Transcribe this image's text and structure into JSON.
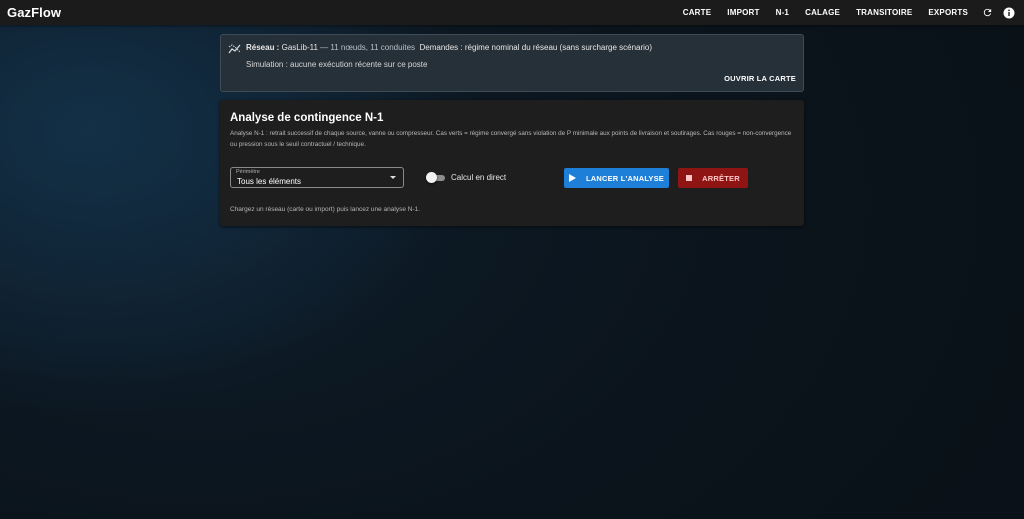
{
  "app": {
    "title": "GazFlow"
  },
  "nav": {
    "items": [
      {
        "label": "CARTE"
      },
      {
        "label": "IMPORT"
      },
      {
        "label": "N-1"
      },
      {
        "label": "CALAGE"
      },
      {
        "label": "TRANSITOIRE"
      },
      {
        "label": "EXPORTS"
      }
    ],
    "icons": [
      "refresh-icon",
      "info-icon"
    ]
  },
  "network_card": {
    "icon": "network-chart-icon",
    "reseau_label": "Réseau :",
    "reseau_name": "GasLib-11",
    "reseau_stats": "— 11 nœuds, 11 conduites",
    "demandes": "Demandes : régime nominal du réseau (sans surcharge scénario)",
    "simulation": "Simulation : aucune exécution récente sur ce poste",
    "open_map_label": "OUVRIR LA CARTE"
  },
  "n1_card": {
    "title": "Analyse de contingence N-1",
    "description": "Analyse N-1 : retrait successif de chaque source, vanne ou compresseur. Cas verts = régime convergé sans violation de P minimale aux points de livraison et soutirages. Cas rouges = non-convergence ou pression sous le seuil contractuel / technique.",
    "perimeter": {
      "label": "Périmètre",
      "value": "Tous les éléments"
    },
    "live_toggle": {
      "label": "Calcul en direct",
      "checked": false
    },
    "run_label": "LANCER L'ANALYSE",
    "stop_label": "ARRÊTER",
    "hint": "Chargez un réseau (carte ou import) puis lancez une analyse N-1."
  },
  "colors": {
    "appbar": "#1b1b1b",
    "primary": "#1e7fd8",
    "danger": "#8f1515",
    "card": "#1e1e1e",
    "info_card": "#263038"
  }
}
